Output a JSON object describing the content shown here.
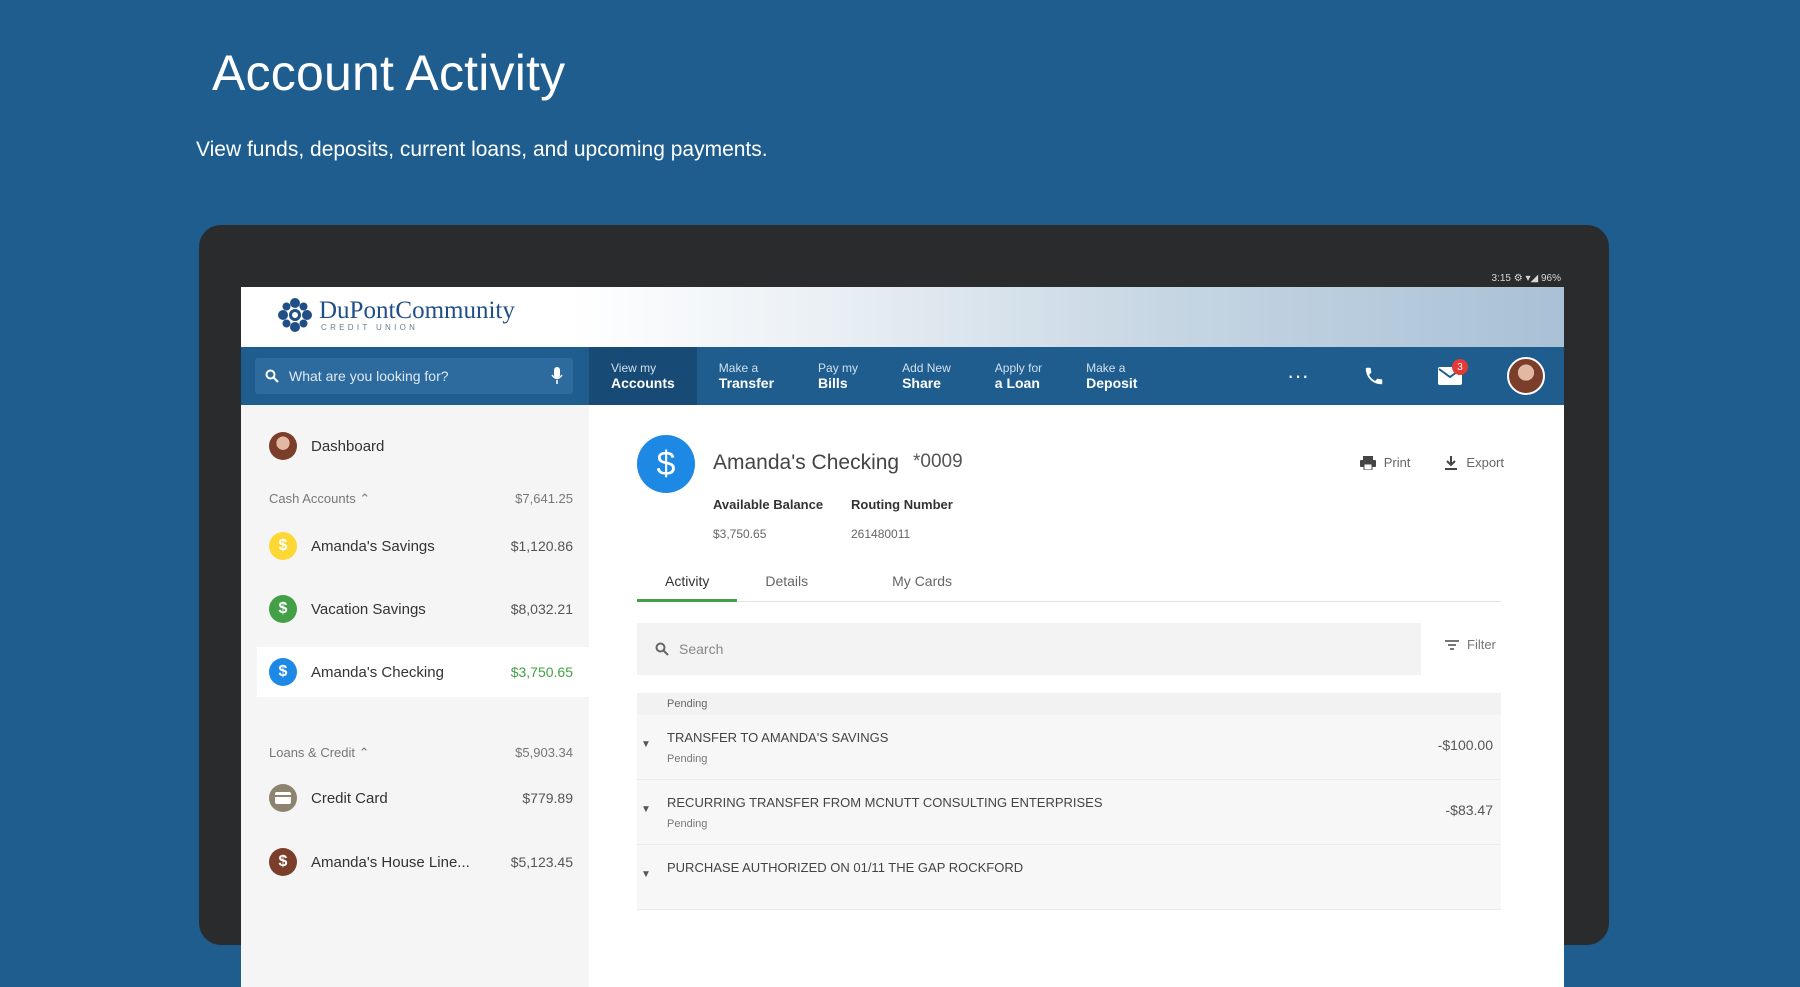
{
  "hero": {
    "title": "Account Activity",
    "subtitle": "View funds, deposits, current loans, and upcoming payments."
  },
  "device": {
    "status_text": "3:15  ⚙ ▾◢ 96%"
  },
  "brand": {
    "name": "DuPontCommunity",
    "tagline": "CREDIT UNION"
  },
  "nav": {
    "search_placeholder": "What are you looking for?",
    "items": [
      {
        "line1": "View my",
        "line2": "Accounts",
        "active": true
      },
      {
        "line1": "Make a",
        "line2": "Transfer"
      },
      {
        "line1": "Pay my",
        "line2": "Bills"
      },
      {
        "line1": "Add New",
        "line2": "Share"
      },
      {
        "line1": "Apply for",
        "line2": "a Loan"
      },
      {
        "line1": "Make a",
        "line2": "Deposit"
      }
    ],
    "more_glyph": "···",
    "mail_badge": "3"
  },
  "sidebar": {
    "dashboard_label": "Dashboard",
    "cash_header": {
      "label": "Cash Accounts",
      "amount": "$7,641.25"
    },
    "cash_accounts": [
      {
        "label": "Amanda's Savings",
        "amount": "$1,120.86",
        "icon": "dollar-icon",
        "color": "#fdd835"
      },
      {
        "label": "Vacation Savings",
        "amount": "$8,032.21",
        "icon": "dollar-icon",
        "color": "#43a047"
      },
      {
        "label": "Amanda's Checking",
        "amount": "$3,750.65",
        "icon": "dollar-icon",
        "color": "#1e88e5",
        "selected": true
      }
    ],
    "loans_header": {
      "label": "Loans & Credit",
      "amount": "$5,903.34"
    },
    "loans": [
      {
        "label": "Credit Card",
        "amount": "$779.89",
        "icon": "credit-card-icon"
      },
      {
        "label": "Amanda's House Line...",
        "amount": "$5,123.45",
        "icon": "dollar-icon"
      }
    ]
  },
  "account": {
    "name": "Amanda's Checking",
    "number": "*0009",
    "print_label": "Print",
    "export_label": "Export",
    "available_balance_label": "Available Balance",
    "available_balance": "$3,750.65",
    "routing_label": "Routing Number",
    "routing": "261480011"
  },
  "tabs": [
    "Activity",
    "Details",
    "My Cards"
  ],
  "activity": {
    "search_placeholder": "Search",
    "filter_label": "Filter",
    "pending_header": "Pending",
    "transactions": [
      {
        "description": "TRANSFER TO AMANDA'S SAVINGS",
        "status": "Pending",
        "amount": "-$100.00"
      },
      {
        "description": "RECURRING TRANSFER FROM MCNUTT CONSULTING ENTERPRISES",
        "status": "Pending",
        "amount": "-$83.47"
      },
      {
        "description": "PURCHASE AUTHORIZED ON 01/11 THE GAP ROCKFORD",
        "status": "",
        "amount": ""
      }
    ]
  },
  "colors": {
    "background": "#1f5d8f",
    "nav": "#1f5d8f",
    "accent_green": "#43a047",
    "checking_blue": "#1e88e5"
  }
}
